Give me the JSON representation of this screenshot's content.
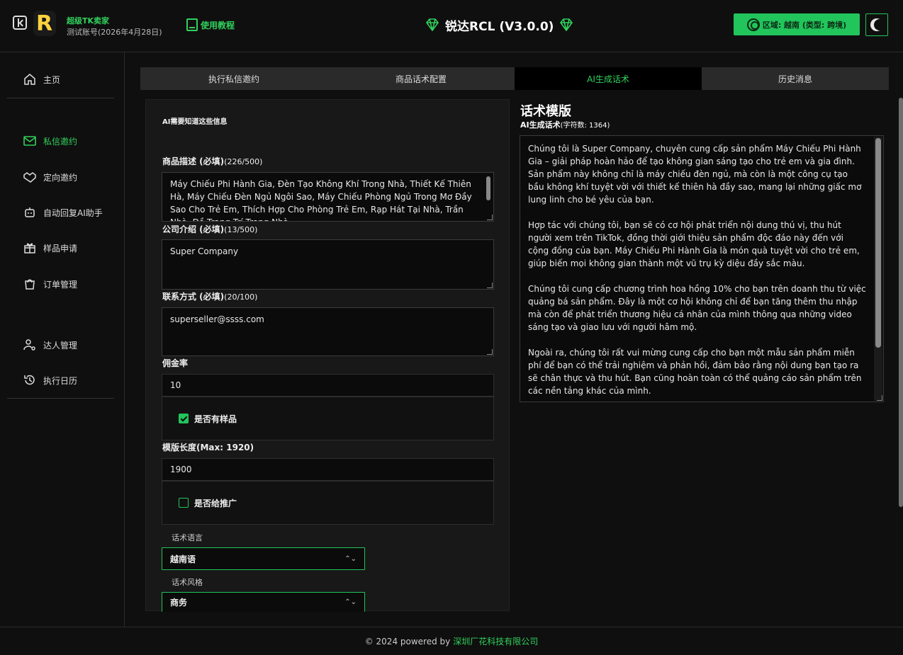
{
  "header": {
    "seller_name": "超级TK卖家",
    "seller_account": "测试账号(2026年4月28日)",
    "logo_letter": "R",
    "tutorial_label": "使用教程",
    "app_title": "锐达RCL (V3.0.0)",
    "region_label": "区域: 越南 (类型: 跨境)"
  },
  "sidebar": {
    "items": [
      {
        "label": "主页",
        "icon": "home-icon"
      },
      {
        "label": "私信邀约",
        "icon": "mail-icon"
      },
      {
        "label": "定向邀约",
        "icon": "handshake-icon"
      },
      {
        "label": "自动回复AI助手",
        "icon": "robot-icon"
      },
      {
        "label": "样品申请",
        "icon": "gift-icon"
      },
      {
        "label": "订单管理",
        "icon": "shopping-bag-icon"
      },
      {
        "label": "达人管理",
        "icon": "user-gear-icon"
      },
      {
        "label": "执行日历",
        "icon": "history-icon"
      }
    ]
  },
  "tabs": [
    "执行私信邀约",
    "商品话术配置",
    "AI生成话术",
    "历史消息"
  ],
  "form": {
    "heading": "AI需要知道这些信息",
    "product_label": "商品描述 (必填)",
    "product_count": "(226/500)",
    "product_text": "Máy Chiếu Phi Hành Gia, Đèn Tạo Không Khí Trong Nhà, Thiết Kế Thiên Hà, Máy Chiếu Đèn Ngủ Ngôi Sao, Máy Chiếu Phòng Ngủ Trong Mơ Đầy Sao Cho Trẻ Em, Thích Hợp Cho Phòng Trẻ Em, Rạp Hát Tại Nhà, Trần Nhà, Đồ Trang Trí Trong Nhà",
    "company_label": "公司介绍 (必填)",
    "company_count": "(13/500)",
    "company_text": "Super Company",
    "contact_label": "联系方式 (必填)",
    "contact_count": "(20/100)",
    "contact_text": "superseller@ssss.com",
    "commission_label": "佣金率",
    "commission_value": "10",
    "sample_label": "是否有样品",
    "sample_checked": true,
    "length_label": "模版长度(Max: 1920)",
    "length_value": "1900",
    "promote_label": "是否给推广",
    "promote_checked": false,
    "language_label": "话术语言",
    "language_value": "越南语",
    "style_label": "话术风格",
    "style_value": "商务"
  },
  "template": {
    "title": "话术模版",
    "subtitle": "AI生成话术",
    "char_count": "(字符数: 1364)",
    "text": "Chúng tôi là Super Company, chuyên cung cấp sản phẩm Máy Chiếu Phi Hành Gia – giải pháp hoàn hảo để tạo không gian sáng tạo cho trẻ em và gia đình. Sản phẩm này không chỉ là máy chiếu đèn ngủ, mà còn là một công cụ tạo bầu không khí tuyệt vời với thiết kế thiên hà đầy sao, mang lại những giấc mơ lung linh cho bé yêu của bạn.\n\nHợp tác với chúng tôi, bạn sẽ có cơ hội phát triển nội dung thú vị, thu hút người xem trên TikTok, đồng thời giới thiệu sản phẩm độc đáo này đến với cộng đồng của bạn. Máy Chiếu Phi Hành Gia là món quà tuyệt vời cho trẻ em, giúp biến mọi không gian thành một vũ trụ kỳ diệu đầy sắc màu.\n\nChúng tôi cung cấp chương trình hoa hồng 10% cho bạn trên doanh thu từ việc quảng bá sản phẩm. Đây là một cơ hội không chỉ để bạn tăng thêm thu nhập mà còn để phát triển thương hiệu cá nhân của mình thông qua những video sáng tạo và giao lưu với người hâm mộ.\n\nNgoài ra, chúng tôi rất vui mừng cung cấp cho bạn một mẫu sản phẩm miễn phí để bạn có thể trải nghiệm và phản hồi, đảm bảo rằng nội dung bạn tạo ra sẽ chân thực và thu hút. Bạn cũng hoàn toàn có thể quảng cáo sản phẩm trên các nền tảng khác của mình."
  },
  "footer": {
    "prefix": "© 2024 powered by",
    "company": "深圳厂花科技有限公司"
  },
  "colors": {
    "accent": "#21c55b",
    "background": "#0f0f0f"
  }
}
